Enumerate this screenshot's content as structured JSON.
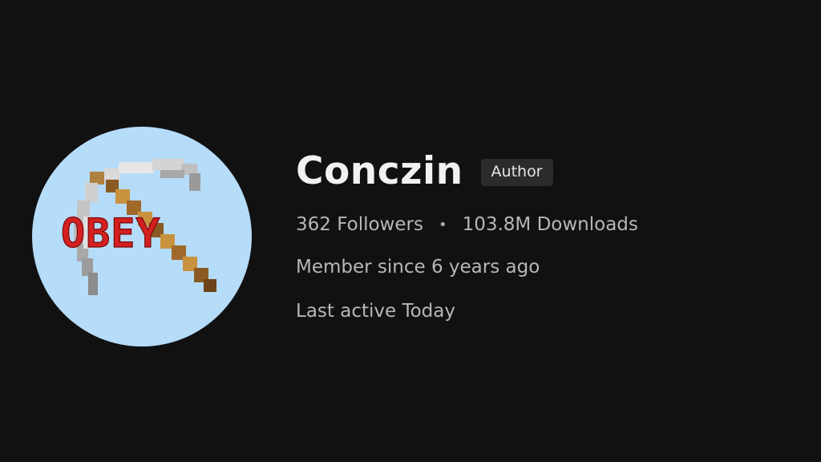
{
  "profile": {
    "avatar_logo_text": "OBEY",
    "username": "Conczin",
    "role_badge": "Author",
    "followers": "362 Followers",
    "separator": "•",
    "downloads": "103.8M Downloads",
    "member_since": "Member since 6 years ago",
    "last_active": "Last active Today"
  },
  "colors": {
    "background": "#111112",
    "avatar_background": "#b5dcf8",
    "name_text": "#f1f1f1",
    "secondary_text": "#b7b7b9",
    "badge_background": "#2b2b2d",
    "logo_red": "#d42020"
  }
}
